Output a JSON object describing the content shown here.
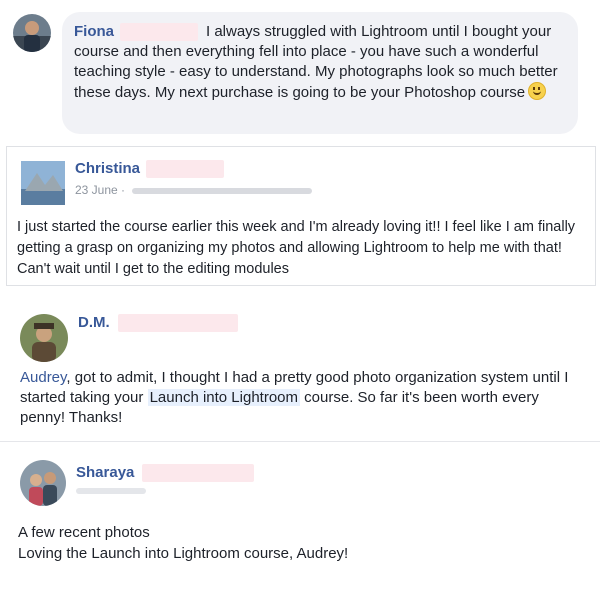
{
  "comments": [
    {
      "author": "Fiona",
      "text": "I always struggled with Lightroom until I bought your course and then everything fell into place - you have such a wonderful teaching style - easy to understand. My photographs look so much better these days. My next purchase is going to be your Photoshop course",
      "emoji": "smiling-face"
    },
    {
      "author": "Christina",
      "date": "23 June · ",
      "text": "I just started the course earlier this week and I'm already loving it!! I feel like I am finally getting a grasp on organizing my photos and allowing Lightroom to help me with that! Can't wait until I get to the editing modules"
    },
    {
      "author": "D.M.",
      "mention": "Audrey",
      "text_a": ", got to admit, I thought I had a pretty good photo organization system until I started taking your ",
      "course_tag": "Launch into Lightroom",
      "text_b": " course. So far it's been worth every penny! Thanks!"
    },
    {
      "author": "Sharaya",
      "line1": "A few recent photos",
      "line2": "Loving the Launch into Lightroom course, Audrey!"
    }
  ],
  "colors": {
    "name": "#385898",
    "bubble": "#f1f2f6",
    "redaction": "#fce8ec"
  }
}
